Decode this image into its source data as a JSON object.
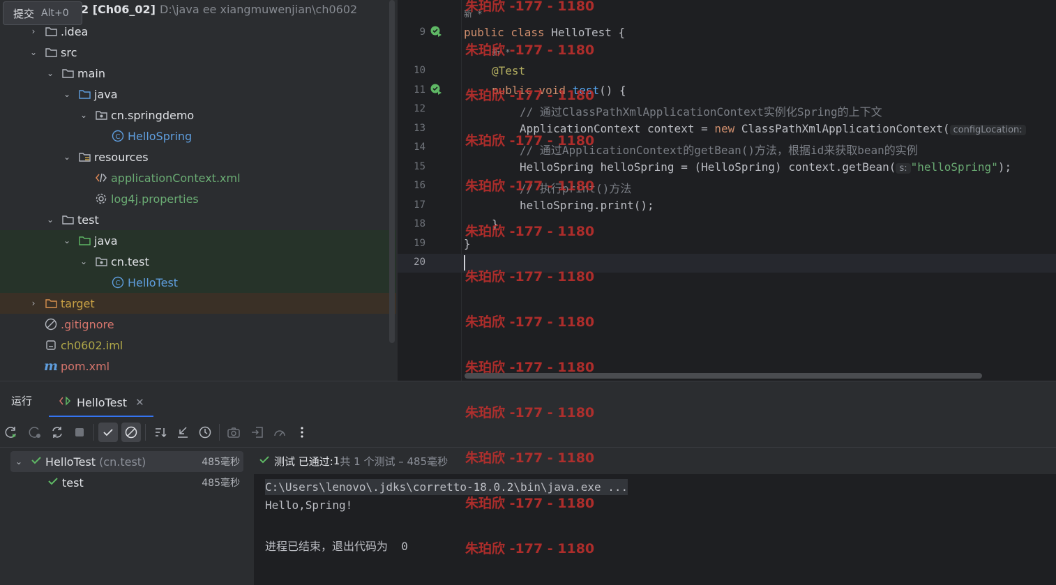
{
  "tooltip": {
    "label": "提交",
    "shortcut": "Alt+0"
  },
  "project": {
    "title_name": "2 [Ch06_02]",
    "title_path": "D:\\java ee xiangmuwenjian\\ch0602",
    "items": [
      {
        "label": ".idea"
      },
      {
        "label": "src"
      },
      {
        "label": "main"
      },
      {
        "label": "java"
      },
      {
        "label": "cn.springdemo"
      },
      {
        "label": "HelloSpring"
      },
      {
        "label": "resources"
      },
      {
        "label": "applicationContext.xml"
      },
      {
        "label": "log4j.properties"
      },
      {
        "label": "test"
      },
      {
        "label": "java"
      },
      {
        "label": "cn.test"
      },
      {
        "label": "HelloTest"
      },
      {
        "label": "target"
      },
      {
        "label": ".gitignore"
      },
      {
        "label": "ch0602.iml"
      },
      {
        "label": "pom.xml"
      }
    ]
  },
  "editor": {
    "new_mark": "新 *",
    "line_numbers": [
      "9",
      "10",
      "11",
      "12",
      "13",
      "14",
      "15",
      "16",
      "17",
      "18",
      "19",
      "20"
    ],
    "lines": {
      "l9_kw": "public class",
      "l9_rest": " HelloTest {",
      "l10": "@Test",
      "l11_kw": "public void",
      "l11_fn": "test",
      "l11_rest": "() {",
      "l12": "// 通过ClassPathXmlApplicationContext实例化Spring的上下文",
      "l13_a": "ApplicationContext context = ",
      "l13_kw": "new",
      "l13_b": " ClassPathXmlApplicationContext(",
      "l13_hint": "configLocation:",
      "l14": "// 通过ApplicationContext的getBean()方法，根据id来获取bean的实例",
      "l15_a": "HelloSpring helloSpring = (HelloSpring) context.getBean(",
      "l15_hint": "s:",
      "l15_str": "\"helloSpring\"",
      "l15_b": ");",
      "l16": "// 执行print()方法",
      "l17": "helloSpring.print();",
      "l18": "}",
      "l19": "}"
    }
  },
  "run": {
    "label": "运行",
    "tab": "HelloTest",
    "tests": [
      {
        "name": "HelloTest",
        "pkg": "(cn.test)",
        "time": "485毫秒"
      },
      {
        "name": "test",
        "time": "485毫秒"
      }
    ],
    "status_prefix": "测试 已通过: ",
    "status_count": "1",
    "status_rest": "共 1 个测试 – 485毫秒",
    "console": {
      "cmd": "C:\\Users\\lenovo\\.jdks\\corretto-18.0.2\\bin\\java.exe ...",
      "out1": "Hello,Spring!",
      "out2": "进程已结束，退出代码为  0"
    }
  },
  "watermark": "朱珀欣 -177 - 1180",
  "colors": {
    "accent": "#3574f0",
    "pass": "#5fb865",
    "watermark": "#c6302d"
  }
}
